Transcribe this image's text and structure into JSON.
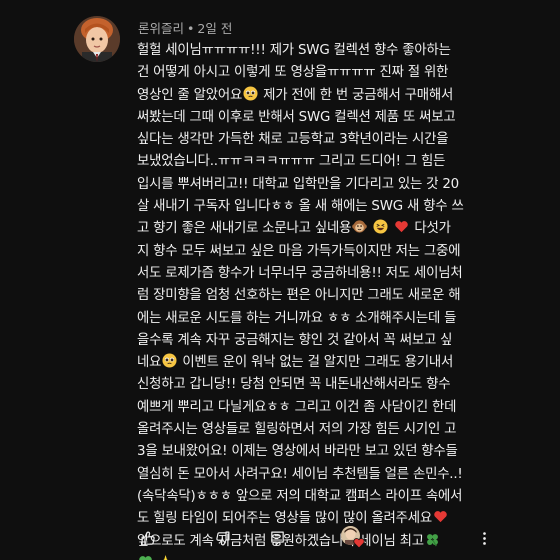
{
  "comment": {
    "author": "론위즐리",
    "time": "2일 전",
    "avatar_icon": "ron-weasley-avatar",
    "lines": [
      "헐헐 세이님ㅠㅠㅠㅠ!!! 제가 SWG 컬렉션 향수 좋아하는",
      "건 어떻게 아시고 이렇게 또 영상을ㅠㅠㅠㅠ 진짜 절 위한",
      "영상인 줄 알았어요",
      "제가 전에 한 번 궁금해서 구매해서",
      "써봤는데 그때 이후로 반해서 SWG 컬렉션 제품 또 써보고",
      "싶다는 생각만 가득한 채로 고등학교 3학년이라는 시간을",
      "보냈었습니다..ㅠㅠㅋㅋㅋㅠㅠㅠ 그리고 드디어! 그 힘든",
      "입시를 뿌셔버리고!! 대학교 입학만을 기다리고 있는 갓 20",
      "살 새내기 구독자 입니다ㅎㅎ 올 새 해에는 SWG 새 향수 쓰",
      "고 향기 좋은 새내기로 소문나고 싶네용",
      "다섯가",
      "지 향수 모두 써보고 싶은 마음 가득가득이지만 저는 그중에",
      "서도 로제가즘 향수가 너무너무 궁금하네용!! 저도 세이님처",
      "럼 장미향을 엄청 선호하는 편은 아니지만 그래도 새로운 해",
      "에는 새로운 시도를 하는 거니까요 ㅎㅎ 소개해주시는데 들",
      "을수록 계속 자꾸 궁금해지는 향인 것 같아서 꼭 써보고 싶",
      "네요",
      "이벤트 운이 워낙 없는 걸 알지만 그래도 용기내서",
      "신청하고 갑니당!! 당첨 안되면 꼭 내돈내산해서라도 향수",
      "예쁘게 뿌리고 다닐게요ㅎㅎ 그리고 이건 좀 사담이긴 한데",
      "올려주시는 영상들로 힐링하면서 저의 가장 힘든 시기인 고",
      "3을 보내왔어요! 이제는 영상에서 바라만 보고 있던 향수들",
      "열심히 돈 모아서 사려구요! 세이님 추천템들 얼른 손민수..!",
      "(속닥속닥)ㅎㅎㅎ 앞으로 저의 대학교 캠퍼스 라이프 속에서",
      "도 힐링 타임이 되어주는 영상들 많이 많이 올려주세요",
      "앞으로도 계속 지금처럼 응원하겠습니다 세이님 최고"
    ],
    "emojis": {
      "pleading": "pleading-face-emoji",
      "monkey": "monkey-face-emoji",
      "grin": "grinning-squinting-face-emoji",
      "red_heart": "red-heart-emoji",
      "clover": "four-leaf-clover-emoji",
      "green_heart": "green-heart-emoji",
      "sparkles": "sparkles-emoji"
    }
  },
  "actions": {
    "like_icon": "thumbs-up-icon",
    "dislike_icon": "thumbs-down-icon",
    "reply_icon": "reply-icon",
    "hearted_by_creator": "creator-heart-badge",
    "more_icon": "more-vertical-icon"
  },
  "colors": {
    "background": "#0f0f0f",
    "text": "#f1f1f1",
    "meta": "#aaaaaa",
    "heart": "#e53935"
  }
}
